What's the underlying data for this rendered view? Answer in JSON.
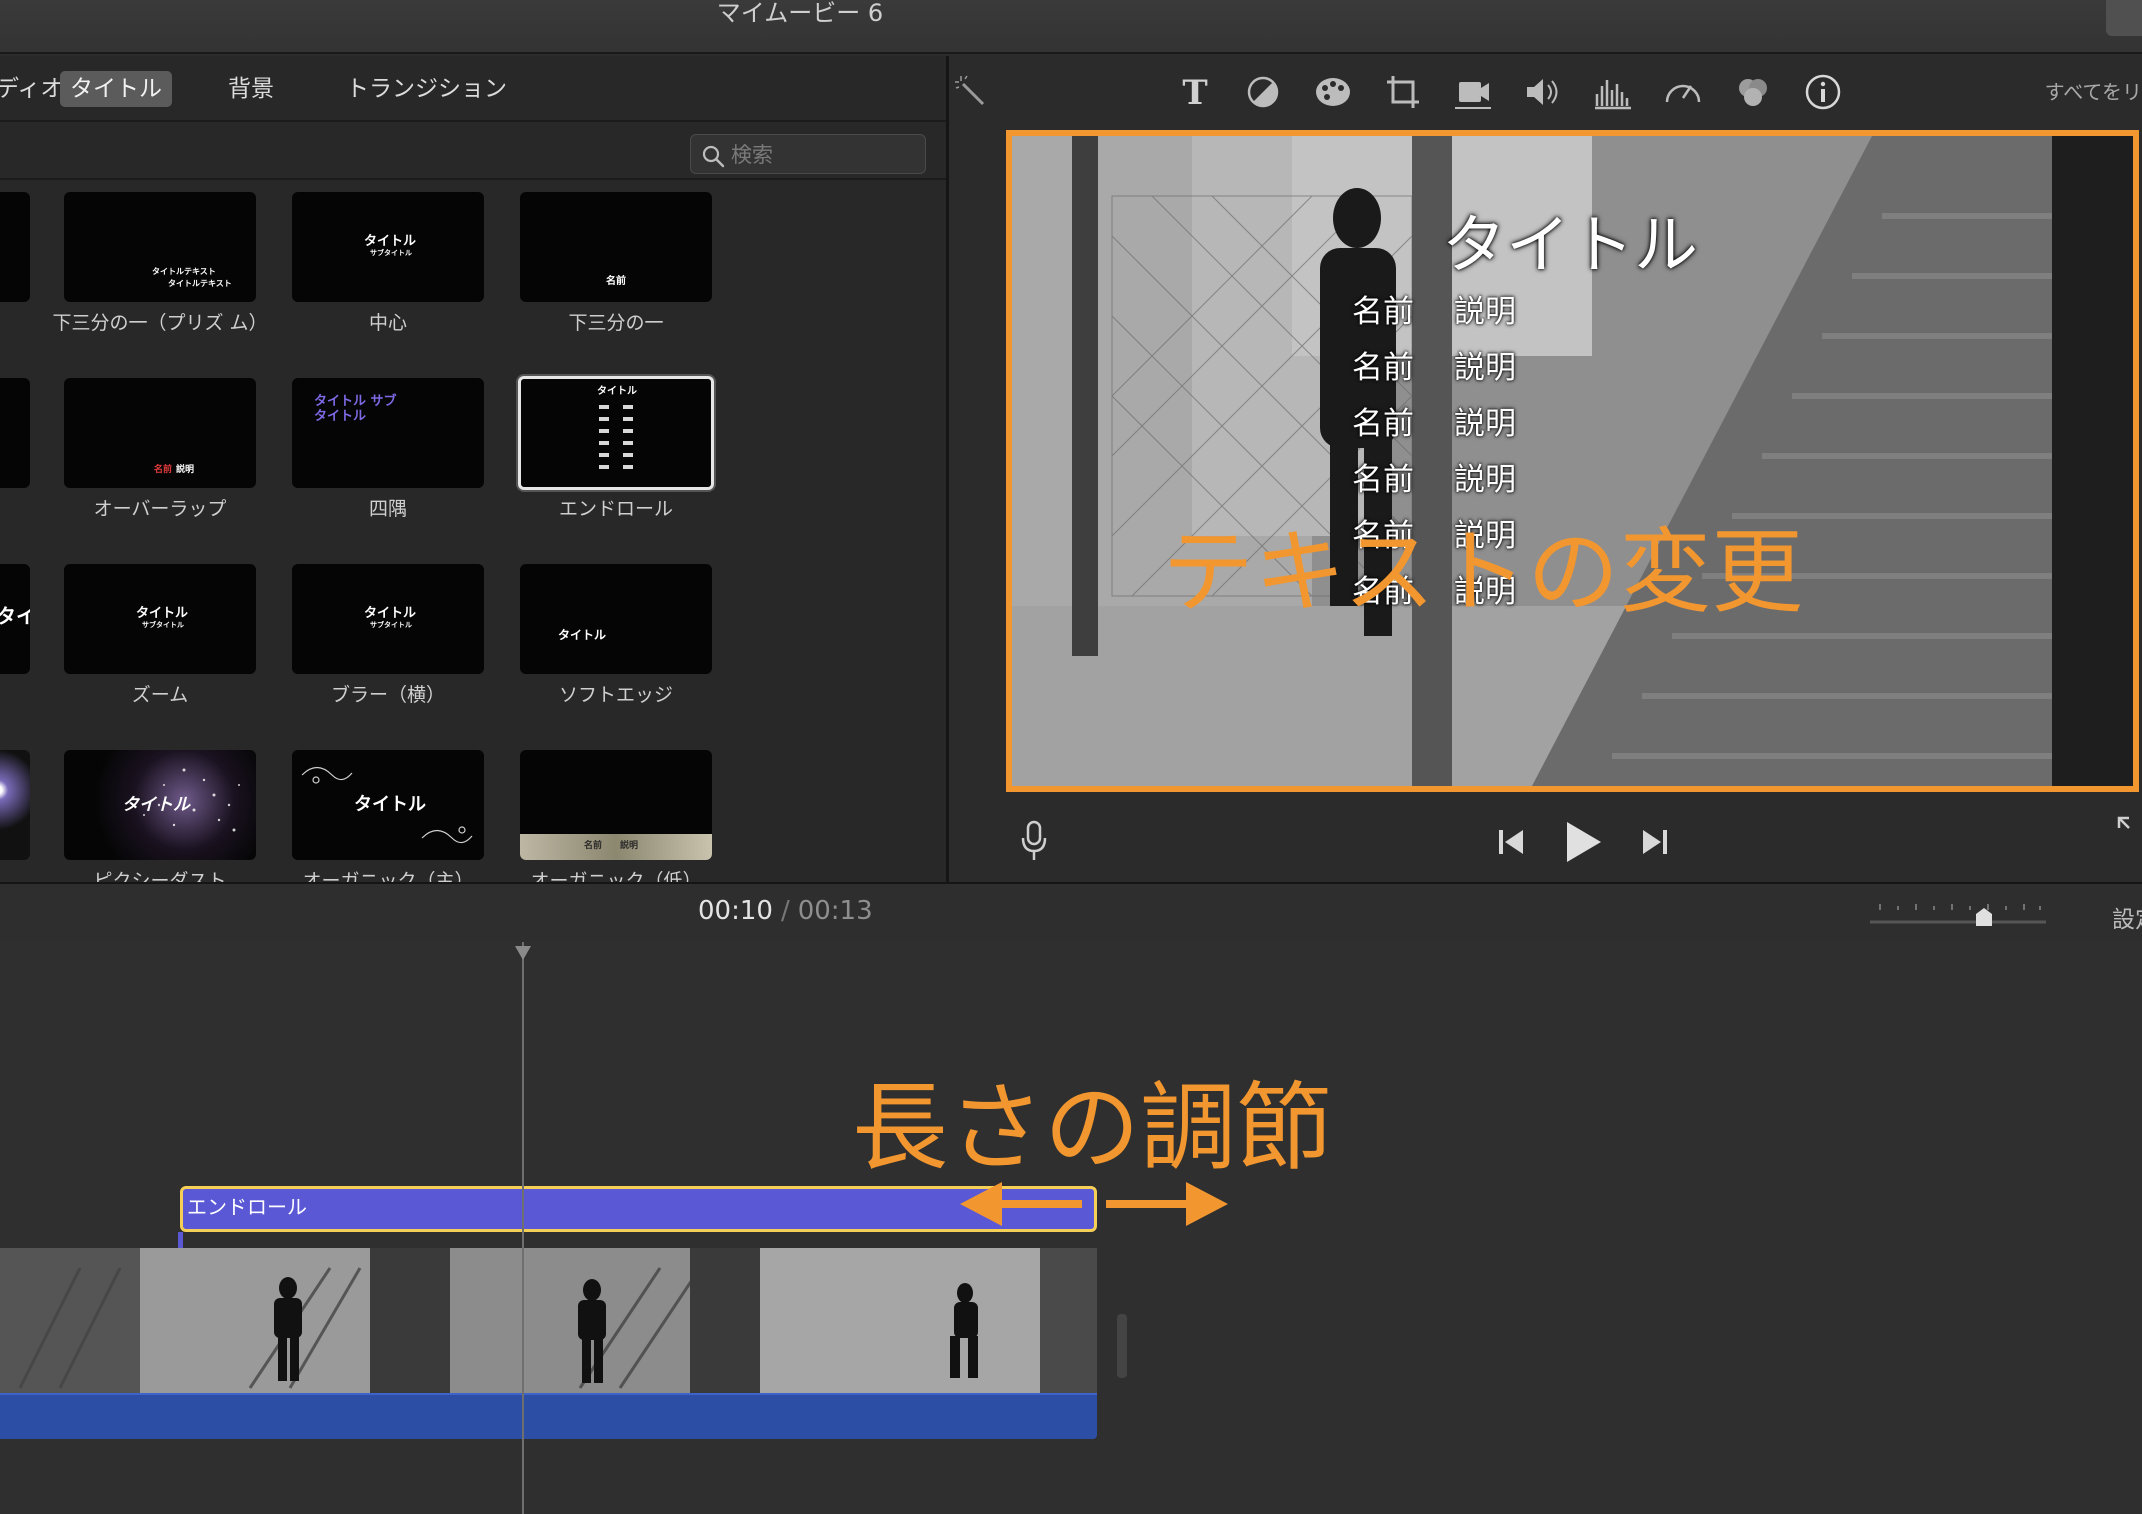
{
  "window": {
    "title": "マイムービー 6"
  },
  "browser": {
    "tabs": [
      {
        "label": "ディオ"
      },
      {
        "label": "タイトル"
      },
      {
        "label": "背景"
      },
      {
        "label": "トランジション"
      }
    ],
    "search": {
      "placeholder": "検索",
      "value": ""
    },
    "tiles": [
      {
        "label": "下三分の一（プリズ ム）"
      },
      {
        "label": "中心"
      },
      {
        "label": "下三分の一"
      },
      {
        "label": "オーバーラップ"
      },
      {
        "label": "四隅"
      },
      {
        "label": "エンドロール"
      },
      {
        "label": "ズーム"
      },
      {
        "label": "ブラー（横）"
      },
      {
        "label": "ソフトエッジ"
      },
      {
        "label": "ピクシーダスト"
      },
      {
        "label": "オーガニック（主）"
      },
      {
        "label": "オーガニック（低）"
      }
    ],
    "thumb_text": {
      "title": "タイトル",
      "subtitle": "サブタイトル",
      "prism_line1": "タイトルテキスト",
      "prism_line2": "タイトルテキスト",
      "name": "名前",
      "desc": "説明",
      "title_sub": "タイトル サブタイトル"
    }
  },
  "viewer": {
    "reset_all": "すべてをリ",
    "preview": {
      "title": "タイトル",
      "credits": [
        {
          "name": "名前",
          "desc": "説明"
        },
        {
          "name": "名前",
          "desc": "説明"
        },
        {
          "name": "名前",
          "desc": "説明"
        },
        {
          "name": "名前",
          "desc": "説明"
        },
        {
          "name": "名前",
          "desc": "説明"
        },
        {
          "name": "名前",
          "desc": "説明"
        }
      ]
    },
    "annotation": "テキストの変更"
  },
  "timeline": {
    "current_time": "00:10",
    "separator": "/",
    "total_time": "00:13",
    "settings_label": "設定",
    "title_clip_label": "エンドロール",
    "annotation": "長さの調節"
  },
  "colors": {
    "accent_orange": "#f2962f",
    "title_clip": "#5a58d5",
    "clip_border": "#f6cf57",
    "audio": "#2c4fa5"
  }
}
